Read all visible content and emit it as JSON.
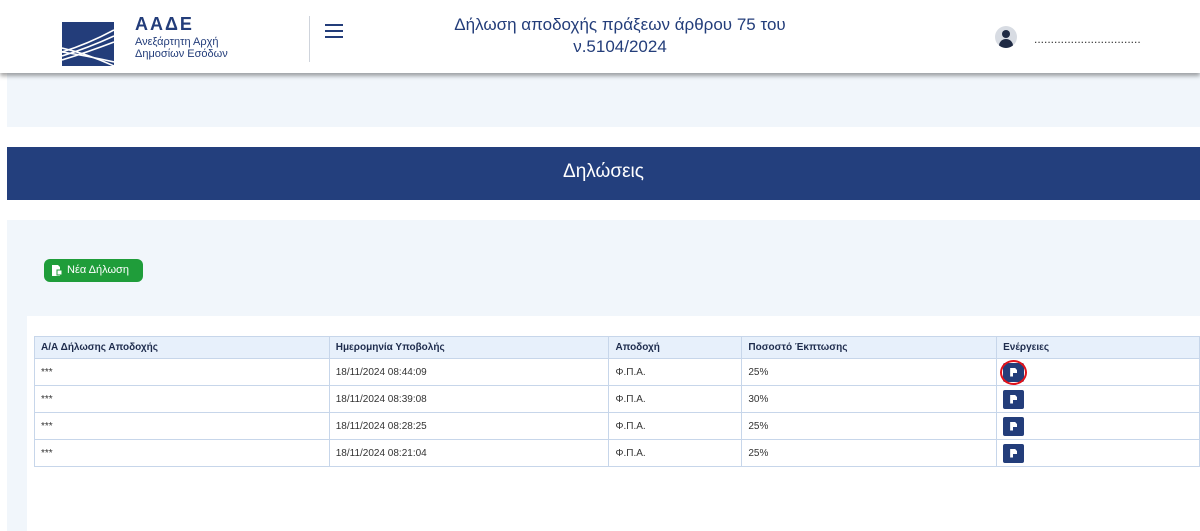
{
  "header": {
    "logo_title": "ΑΑΔΕ",
    "logo_subtitle_line1": "Ανεξάρτητη Αρχή",
    "logo_subtitle_line2": "Δημοσίων Εσόδων",
    "page_title_line1": "Δήλωση αποδοχής πράξεων άρθρου 75 του",
    "page_title_line2": "ν.5104/2024",
    "user_name": "................................"
  },
  "section": {
    "title": "Δηλώσεις"
  },
  "actions": {
    "new_declaration_label": "Νέα Δήλωση"
  },
  "table": {
    "columns": [
      "Α/Α Δήλωσης Αποδοχής",
      "Ημερομηνία Υποβολής",
      "Αποδοχή",
      "Ποσοστό Έκπτωσης",
      "Ενέργειες"
    ],
    "rows": [
      {
        "id": "***",
        "date": "18/11/2024 08:44:09",
        "acceptance": "Φ.Π.Α.",
        "discount": "25%"
      },
      {
        "id": "***",
        "date": "18/11/2024 08:39:08",
        "acceptance": "Φ.Π.Α.",
        "discount": "30%"
      },
      {
        "id": "***",
        "date": "18/11/2024 08:28:25",
        "acceptance": "Φ.Π.Α.",
        "discount": "25%"
      },
      {
        "id": "***",
        "date": "18/11/2024 08:21:04",
        "acceptance": "Φ.Π.Α.",
        "discount": "25%"
      }
    ]
  },
  "icons": {
    "logo": "aade-logo-icon",
    "menu": "hamburger-menu-icon",
    "user": "user-avatar-icon",
    "new": "document-add-icon",
    "row_action": "pdf-document-icon"
  },
  "colors": {
    "brand_blue": "#233f7d",
    "panel_bg": "#f1f6fb",
    "success_green": "#1f9d3a",
    "highlight_red": "#e0121b"
  }
}
